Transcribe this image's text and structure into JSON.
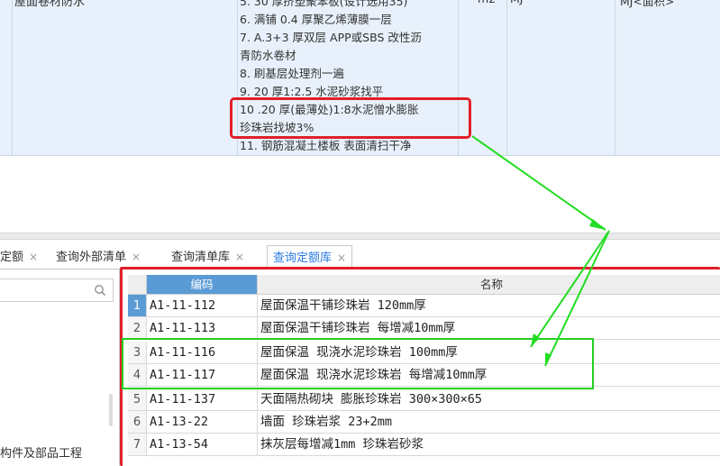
{
  "top": {
    "name_cell": "屋面卷材防水",
    "spec_lines": [
      "5.  30 厚挤塑聚苯板(设计选用35)",
      "6.  满铺 0.4 厚聚乙烯薄膜一层",
      "7.  A.3+3 厚双层 APP或SBS 改性沥",
      "青防水卷材",
      "8.  刷基层处理剂一遍",
      "9.  20 厚1:2.5 水泥砂浆找平",
      "10  .20 厚(最薄处)1:8水泥憎水膨胀",
      "珍珠岩找坡3%",
      "11.  钢筋混凝土楼板 表面清扫干净"
    ],
    "unit": "m2",
    "quantity": "MJ",
    "remark": "MJ<面积>"
  },
  "tabs": [
    {
      "label": "查询定额",
      "close": "×"
    },
    {
      "label": "查询外部清单",
      "close": "×"
    },
    {
      "label": "查询清单库",
      "close": "×"
    },
    {
      "label": "查询定额库",
      "close": "×"
    }
  ],
  "left_panel": {
    "search_placeholder": "",
    "tree_item": "构件及部品工程"
  },
  "grid": {
    "headers": {
      "code": "编码",
      "name": "名称"
    },
    "rows": [
      {
        "idx": "1",
        "code": "A1-11-112",
        "name": "屋面保温干铺珍珠岩 120mm厚"
      },
      {
        "idx": "2",
        "code": "A1-11-113",
        "name": "屋面保温干铺珍珠岩 每增减10mm厚"
      },
      {
        "idx": "3",
        "code": "A1-11-116",
        "name": "屋面保温 现浇水泥珍珠岩 100mm厚"
      },
      {
        "idx": "4",
        "code": "A1-11-117",
        "name": "屋面保温 现浇水泥珍珠岩 每增减10mm厚"
      },
      {
        "idx": "5",
        "code": "A1-11-137",
        "name": "天面隔热砌块 膨胀珍珠岩 300×300×65"
      },
      {
        "idx": "6",
        "code": "A1-13-22",
        "name": "墙面 珍珠岩浆 23+2mm"
      },
      {
        "idx": "7",
        "code": "A1-13-54",
        "name": "抹灰层每增减1mm 珍珠岩砂浆"
      }
    ]
  },
  "colors": {
    "red_highlight": "#e0202a",
    "green_highlight": "#22d022",
    "header_accent": "#5b9bd5",
    "tab_active": "#2a7ae2"
  }
}
